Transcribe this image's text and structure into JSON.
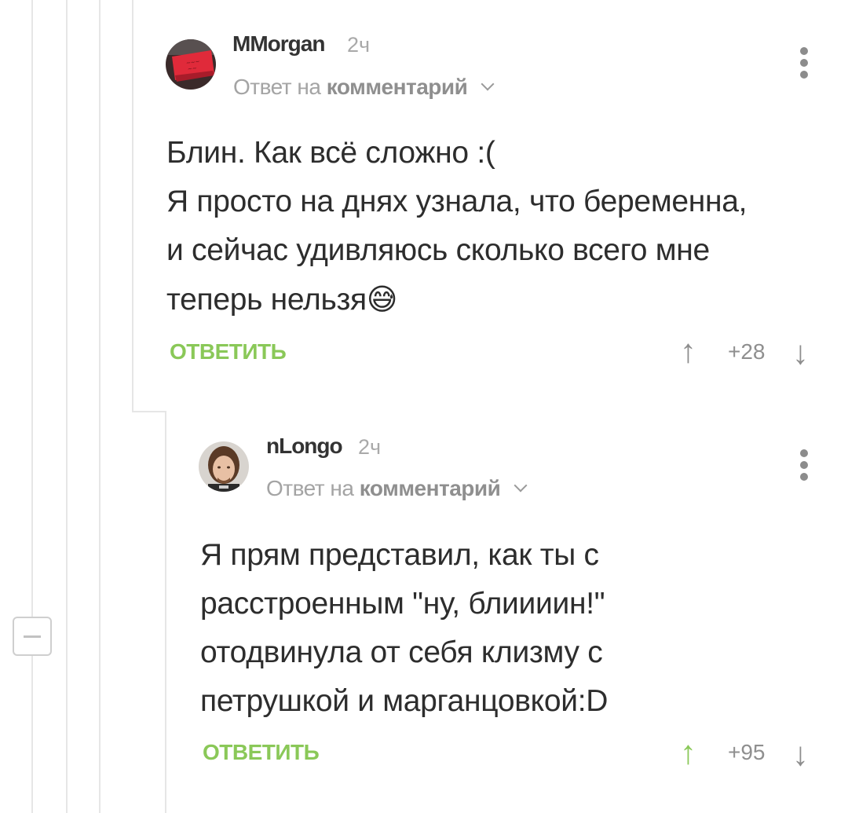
{
  "comments": [
    {
      "author": "MMorgan",
      "time": "2ч",
      "reply_prefix": "Ответ на",
      "reply_target": "комментарий",
      "body": "Блин. Как всё сложно :(\nЯ просто на днях узнала, что беременна,\nи сейчас удивляюсь сколько всего мне\nтеперь нельзя",
      "emoji": "😅",
      "reply_label": "ОТВЕТИТЬ",
      "score": "+28",
      "upvoted": false
    },
    {
      "author": "nLongo",
      "time": "2ч",
      "reply_prefix": "Ответ на",
      "reply_target": "комментарий",
      "body": "Я прям представил, как ты с\nрасстроенным \"ну, блиииин!\"\nотодвинула от себя клизму с\nпетрушкой и марганцовкой:D",
      "reply_label": "ОТВЕТИТЬ",
      "score": "+95",
      "upvoted": true
    }
  ],
  "icons": {
    "upvote": "arrow-up-icon",
    "downvote": "arrow-down-icon",
    "menu": "more-vertical-icon",
    "collapse": "minus-icon",
    "chevron": "chevron-down-icon"
  },
  "colors": {
    "accent_green": "#8ac858",
    "thread_line": "#e6e6e6",
    "text": "#2d2d2d",
    "muted": "#a4a4a4"
  }
}
